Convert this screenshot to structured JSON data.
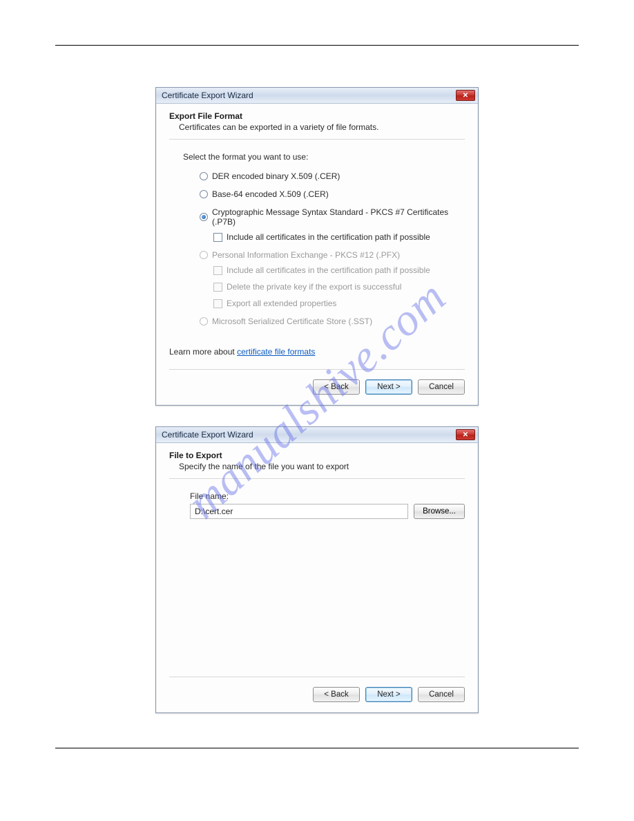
{
  "watermark": "manualshive.com",
  "dialog1": {
    "title": "Certificate Export Wizard",
    "heading": "Export File Format",
    "subheading": "Certificates can be exported in a variety of file formats.",
    "prompt": "Select the format you want to use:",
    "options": {
      "der": "DER encoded binary X.509 (.CER)",
      "base64": "Base-64 encoded X.509 (.CER)",
      "p7b": "Cryptographic Message Syntax Standard - PKCS #7 Certificates (.P7B)",
      "p7b_include": "Include all certificates in the certification path if possible",
      "pfx": "Personal Information Exchange - PKCS #12 (.PFX)",
      "pfx_include": "Include all certificates in the certification path if possible",
      "pfx_delete": "Delete the private key if the export is successful",
      "pfx_extended": "Export all extended properties",
      "sst": "Microsoft Serialized Certificate Store (.SST)"
    },
    "learn_prefix": "Learn more about ",
    "learn_link": "certificate file formats",
    "buttons": {
      "back": "< Back",
      "next": "Next >",
      "cancel": "Cancel"
    }
  },
  "dialog2": {
    "title": "Certificate Export Wizard",
    "heading": "File to Export",
    "subheading": "Specify the name of the file you want to export",
    "field_label": "File name:",
    "filename_value": "D:\\cert.cer",
    "browse": "Browse...",
    "buttons": {
      "back": "< Back",
      "next": "Next >",
      "cancel": "Cancel"
    }
  }
}
